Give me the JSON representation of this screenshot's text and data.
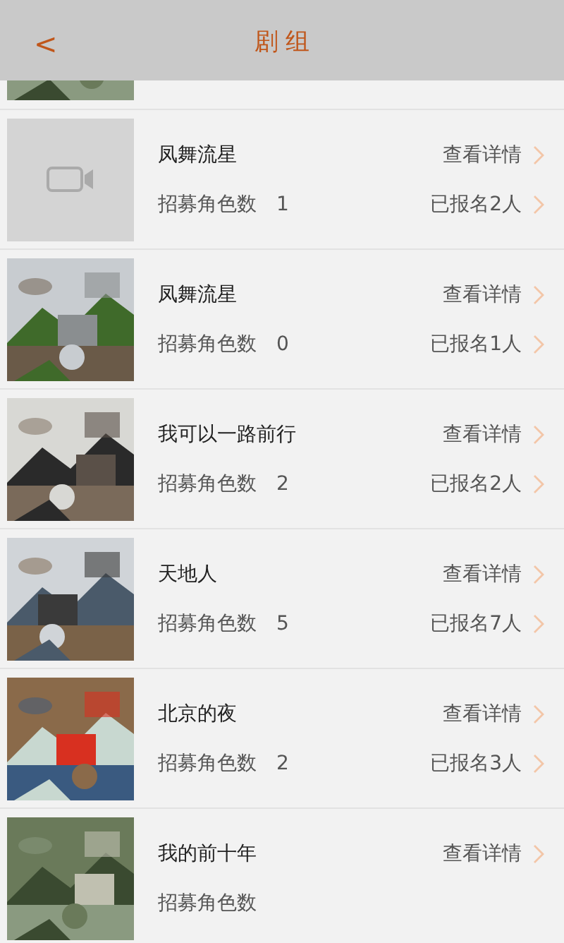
{
  "header": {
    "back": "<",
    "title": "剧 组"
  },
  "rows": [
    {
      "thumbnail": {
        "kind": "picture"
      }
    },
    {
      "thumbnail": {
        "kind": "placeholder"
      },
      "title": "凤舞流星",
      "detail": "查看详情",
      "count_label": "招募角色数",
      "count": "1",
      "signup": "已报名2人"
    },
    {
      "thumbnail": {
        "kind": "picture"
      },
      "title": "凤舞流星",
      "detail": "查看详情",
      "count_label": "招募角色数",
      "count": "0",
      "signup": "已报名1人"
    },
    {
      "thumbnail": {
        "kind": "picture"
      },
      "title": "我可以一路前行",
      "detail": "查看详情",
      "count_label": "招募角色数",
      "count": "2",
      "signup": "已报名2人"
    },
    {
      "thumbnail": {
        "kind": "picture"
      },
      "title": "天地人",
      "detail": "查看详情",
      "count_label": "招募角色数",
      "count": "5",
      "signup": "已报名7人"
    },
    {
      "thumbnail": {
        "kind": "picture"
      },
      "title": "北京的夜",
      "detail": "查看详情",
      "count_label": "招募角色数",
      "count": "2",
      "signup": "已报名3人"
    },
    {
      "thumbnail": {
        "kind": "picture"
      },
      "title": "我的前十年",
      "detail": "查看详情",
      "count_label": "招募角色数"
    }
  ]
}
